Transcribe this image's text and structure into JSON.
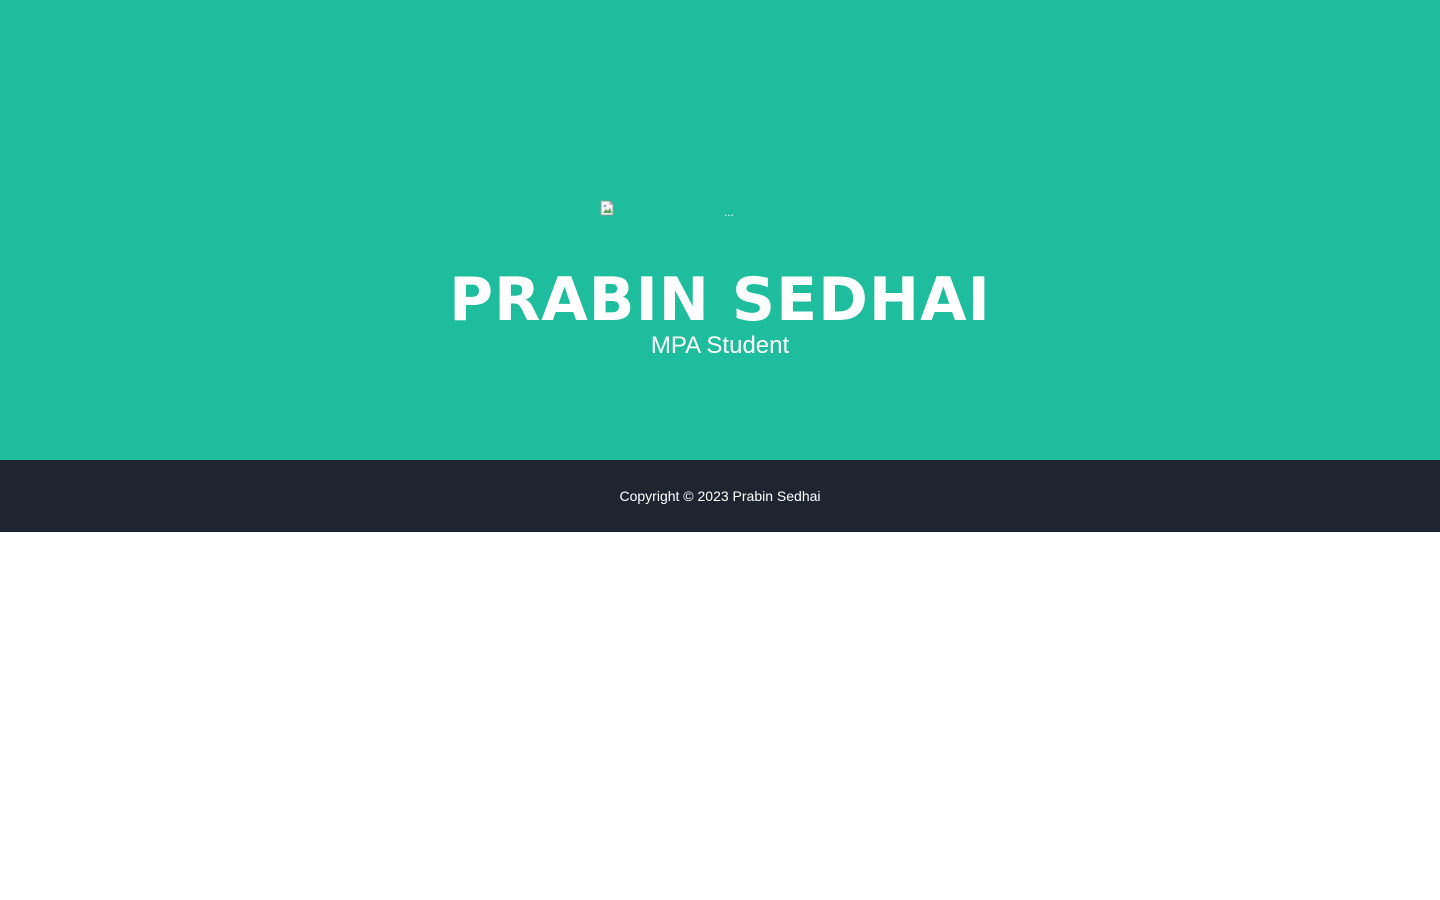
{
  "masthead": {
    "background_color": "#1dbd9d",
    "avatar": {
      "icon": "broken-image-icon",
      "alt_text": "..."
    },
    "name": "PRABIN SEDHAI",
    "subtitle": "MPA Student"
  },
  "footer": {
    "background_color": "#1e2530",
    "copyright": "Copyright © 2023 Prabin Sedhai"
  }
}
